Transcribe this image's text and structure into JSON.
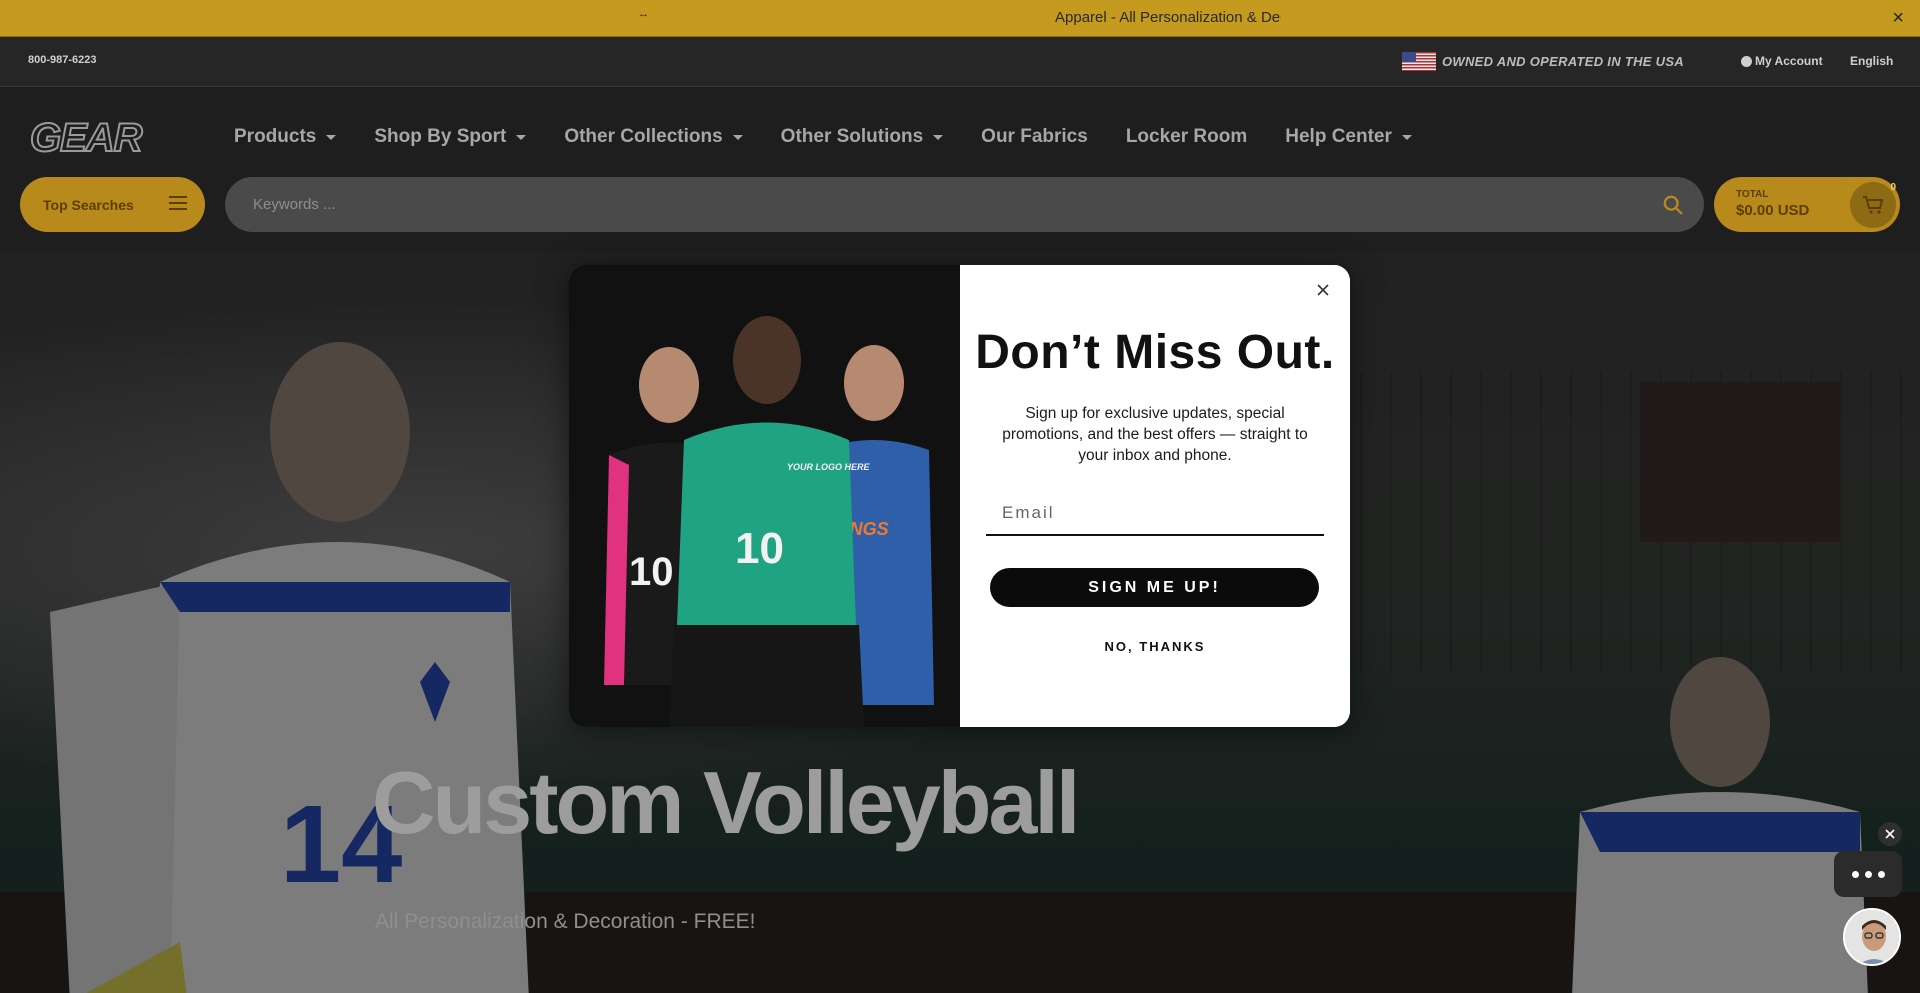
{
  "announcement": {
    "left_glyph": "↔",
    "text": "Apparel - All Personalization & Deco",
    "close_label": "×"
  },
  "utility": {
    "phone": "800-987-6223",
    "usa_text": "OWNED AND OPERATED IN THE USA",
    "account": "My Account",
    "language": "English"
  },
  "brand": {
    "logo_text": "GEAR",
    "accent_color": "#b8891b"
  },
  "nav": {
    "items": [
      {
        "label": "Products",
        "has_dropdown": true
      },
      {
        "label": "Shop By Sport",
        "has_dropdown": true
      },
      {
        "label": "Other Collections",
        "has_dropdown": true
      },
      {
        "label": "Other Solutions",
        "has_dropdown": true
      },
      {
        "label": "Our Fabrics",
        "has_dropdown": false
      },
      {
        "label": "Locker Room",
        "has_dropdown": false
      },
      {
        "label": "Help Center",
        "has_dropdown": true
      }
    ]
  },
  "search": {
    "top_searches_label": "Top Searches",
    "placeholder": "Keywords ..."
  },
  "cart": {
    "total_label": "TOTAL",
    "total_value": "$0.00 USD",
    "count": "0"
  },
  "hero": {
    "title": "Custom Volleyball",
    "subtitle": "All Personalization & Decoration - FREE!"
  },
  "popup": {
    "headline": "Don’t Miss Out.",
    "copy": "Sign up for exclusive updates, special promotions, and the best offers — straight to your inbox and phone.",
    "email_placeholder": "Email",
    "signup_label": "SIGN ME UP!",
    "no_thanks_label": "NO, THANKS",
    "art": {
      "center_number": "10",
      "left_number": "10",
      "center_print": "YOUR LOGO HERE",
      "right_print": "STANGS"
    }
  },
  "chat": {
    "close_label": "×"
  }
}
